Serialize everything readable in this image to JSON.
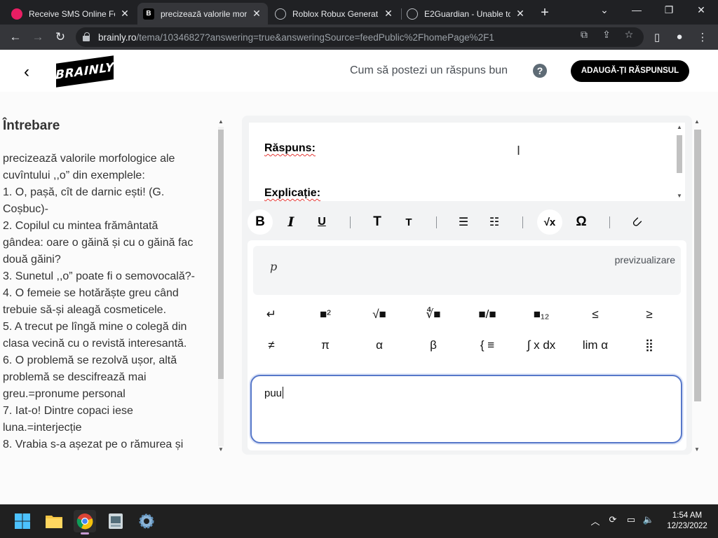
{
  "browser": {
    "tabs": [
      {
        "title": "Receive SMS Online Fo",
        "favicon_color": "#e91e63",
        "favicon_glyph": ""
      },
      {
        "title": "precizează valorile mor",
        "favicon_color": "#000000",
        "favicon_glyph": "B",
        "active": true
      },
      {
        "title": "Roblox Robux Generat",
        "favicon_color": "#9aa0a6",
        "favicon_glyph": "🌐"
      },
      {
        "title": "E2Guardian - Unable to",
        "favicon_color": "#9aa0a6",
        "favicon_glyph": "🌐"
      }
    ],
    "url_host": "brainly.ro",
    "url_path": "/tema/10346827?answering=true&answeringSource=feedPublic%2FhomePage%2F1"
  },
  "header": {
    "logo": "BRAINLY",
    "howto": "Cum să postezi un răspuns bun",
    "help": "?",
    "add_answer": "ADAUGĂ-ȚI RĂSPUNSUL"
  },
  "question": {
    "title": "Întrebare",
    "lines": [
      "precizează valorile morfologice ale",
      "cuvîntului ,,o” din exemplele:",
      "1. O, pașă, cît de darnic ești! (G.",
      "Coșbuc)-",
      "2. Copilul cu mintea frământată",
      "gândea: oare o găină și cu o găină fac",
      "două găini?",
      "3. Sunetul ,,o” poate fi o semovocală?-",
      "4. O femeie se hotărăște greu când",
      "trebuie să-și aleagă cosmeticele.",
      "5. A trecut pe lîngă mine o colegă din",
      "clasa vecină cu o revistă interesantă.",
      "6. O problemă se rezolvă ușor, altă",
      "problemă se descifrează mai",
      "greu.=pronume personal",
      "7. Iat-o! Dintre copaci iese",
      "luna.=interjecție",
      "8. Vrabia s-a așezat pe o rămurea și"
    ]
  },
  "answer": {
    "raspuns_label": "Răspuns:",
    "explicatie_label": "Explicație:",
    "preview_label": "previzualizare",
    "preview_expr": "p",
    "input_value": "puu",
    "symbols_row1": [
      "↵",
      "■²",
      "√■",
      "∜■",
      "■/■",
      "■₁₂",
      "≤",
      "≥"
    ],
    "symbols_row2": [
      "≠",
      "π",
      "α",
      "β",
      "{ ≡",
      "∫ x dx",
      "lim α",
      "⣿"
    ]
  },
  "taskbar": {
    "time": "1:54 AM",
    "date": "12/23/2022"
  }
}
